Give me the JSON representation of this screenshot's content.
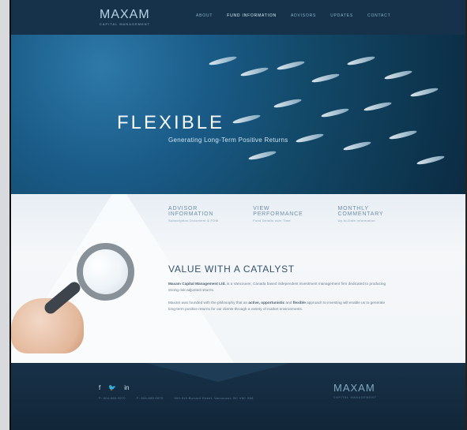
{
  "header": {
    "logo": "MAXAM",
    "logo_sub": "CAPITAL MANAGEMENT",
    "nav": [
      "ABOUT",
      "FUND INFORMATION",
      "ADVISORS",
      "UPDATES",
      "CONTACT"
    ]
  },
  "hero": {
    "title": "FLEXIBLE",
    "subtitle": "Generating Long-Term Positive Returns"
  },
  "links": [
    {
      "title_1": "ADVISOR",
      "title_2": "INFORMATION",
      "sub": "Subscription Document & FOM"
    },
    {
      "title_1": "VIEW",
      "title_2": "PERFORMANCE",
      "sub": "Fund Details over Time"
    },
    {
      "title_1": "MONTHLY",
      "title_2": "COMMENTARY",
      "sub": "Up-to-Date Information"
    }
  ],
  "content": {
    "title": "VALUE WITH A CATALYST",
    "p1_bold": "Maxam Capital Management Ltd.",
    "p1_rest": " is a Vancouver, Canada based independent investment management firm dedicated to producing strong risk-adjusted returns.",
    "p2_start": "Maxam was founded with the philosophy that an ",
    "p2_bold1": "active, opportunistic",
    "p2_mid": " and ",
    "p2_bold2": "flexible",
    "p2_end": " approach to investing will enable us to generate long-term positive returns for our clients through a variety of market environments."
  },
  "footer": {
    "social": [
      "f",
      "🐦",
      "in"
    ],
    "phone_1": "P: 604.685.0970",
    "phone_2": "F: 604.685.0975",
    "address": "900-510 Burrard Street, Vancouver, BC V6C 3A8",
    "logo": "MAXAM",
    "logo_sub": "CAPITAL MANAGEMENT"
  }
}
